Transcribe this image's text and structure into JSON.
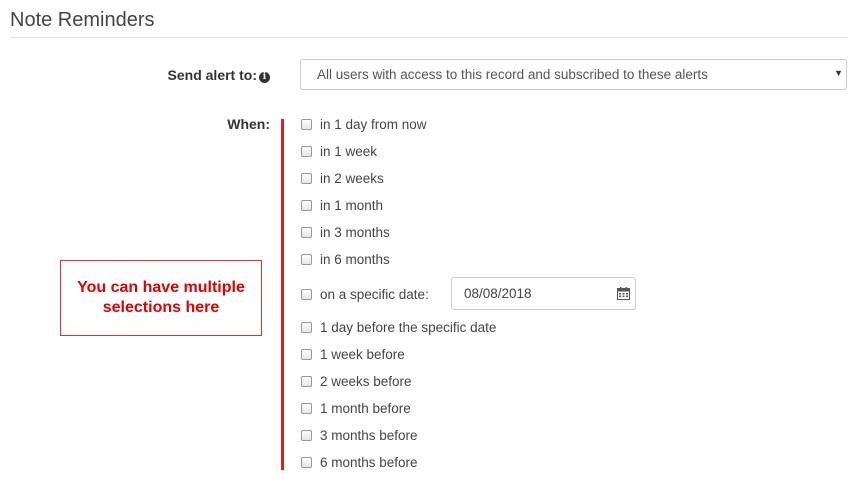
{
  "section": {
    "title": "Note Reminders"
  },
  "send_alert": {
    "label": "Send alert to:",
    "icon": "info-icon",
    "selected": "All users with access to this record and subscribed to these alerts"
  },
  "when": {
    "label": "When:",
    "options": [
      {
        "label": "in 1 day from now",
        "checked": false
      },
      {
        "label": "in 1 week",
        "checked": false
      },
      {
        "label": "in 2 weeks",
        "checked": false
      },
      {
        "label": "in 1 month",
        "checked": false
      },
      {
        "label": "in 3 months",
        "checked": false
      },
      {
        "label": "in 6 months",
        "checked": false
      },
      {
        "label": "on a specific date:",
        "checked": false
      },
      {
        "label": "1 day before the specific date",
        "checked": false
      },
      {
        "label": "1 week before",
        "checked": false
      },
      {
        "label": "2 weeks before",
        "checked": false
      },
      {
        "label": "1 month before",
        "checked": false
      },
      {
        "label": "3 months before",
        "checked": false
      },
      {
        "label": "6 months before",
        "checked": false
      }
    ],
    "specific_date_value": "08/08/2018",
    "date_icon": "calendar-icon"
  },
  "annotation": {
    "text": "You can have multiple selections here",
    "color": "#e00000"
  }
}
